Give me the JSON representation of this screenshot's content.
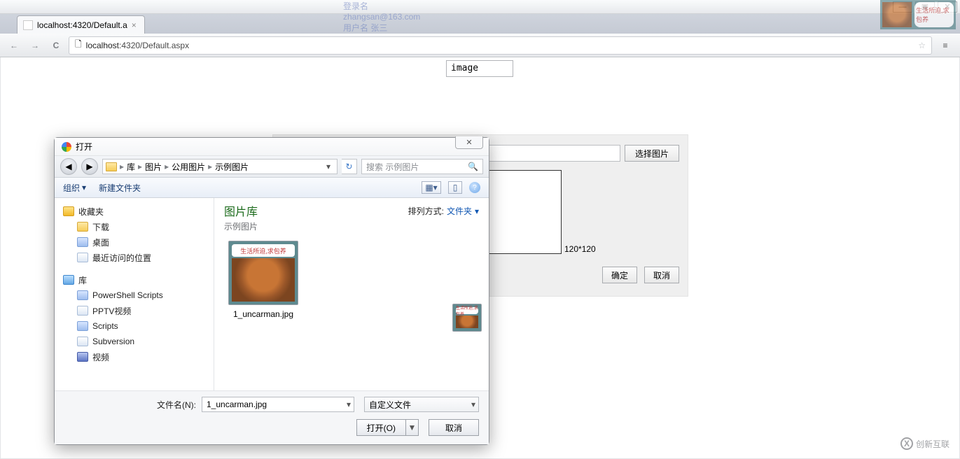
{
  "window_controls": {
    "min": "—",
    "max": "▣",
    "close": "✕"
  },
  "tab": {
    "title": "localhost:4320/Default.a",
    "close": "×"
  },
  "nav": {
    "back": "←",
    "forward": "→",
    "reload": "C"
  },
  "address": {
    "page_icon": "🗋",
    "host": "localhost",
    "rest": ":4320/Default.aspx",
    "star": "☆",
    "menu": "≡"
  },
  "ghost": {
    "l1": "登录名   zhangsan@163.com",
    "l2": "用户名   张三",
    "bubble": "生活所迫,求包养"
  },
  "page": {
    "image_label": "image",
    "choose_btn": "选择图片",
    "size_label": "120*120",
    "ok": "确定",
    "cancel": "取消"
  },
  "dialog": {
    "title": "打开",
    "close": "✕",
    "nav_back": "◀",
    "nav_fwd": "▶",
    "breadcrumb": [
      "库",
      "图片",
      "公用图片",
      "示例图片"
    ],
    "bc_sep": "▸",
    "bc_drop": "▾",
    "refresh": "↻",
    "search_placeholder": "搜索 示例图片",
    "search_icon": "🔍",
    "toolbar": {
      "organize": "组织",
      "new_folder": "新建文件夹",
      "view_icon": "▦",
      "preview_pane": "▯",
      "help": "?"
    },
    "sidebar": {
      "favorites": "收藏夹",
      "fav_items": [
        "下载",
        "桌面",
        "最近访问的位置"
      ],
      "libraries": "库",
      "lib_items": [
        "PowerShell Scripts",
        "PPTV视频",
        "Scripts",
        "Subversion",
        "视频"
      ]
    },
    "content": {
      "lib_heading": "图片库",
      "lib_sub": "示例图片",
      "sort_label": "排列方式:",
      "sort_value": "文件夹",
      "sort_caret": "▾",
      "file_name": "1_uncarman.jpg",
      "thumb_bubble": "生活所迫,求包养"
    },
    "bottom": {
      "filename_label": "文件名(N):",
      "filename_value": "1_uncarman.jpg",
      "filter_value": "自定义文件",
      "open_label": "打开(O)",
      "open_caret": "▼",
      "cancel": "取消"
    }
  },
  "watermark": {
    "glyph": "X",
    "text": "创新互联"
  }
}
